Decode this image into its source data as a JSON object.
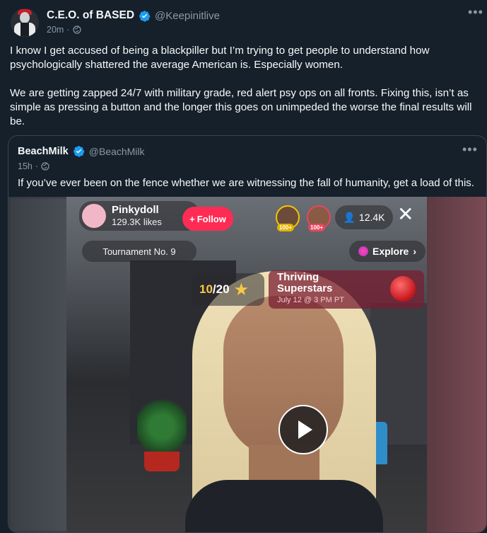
{
  "post": {
    "author_name": "C.E.O. of BASED",
    "author_handle": "@Keepinitlive",
    "time": "20m",
    "more_glyph": "•••",
    "paragraphs": [
      "I know I get accused of being a blackpiller but I’m trying to get people to understand how psychologically shattered the average American is. Especially women.",
      "We are getting zapped 24/7 with military grade, red alert psy ops on all fronts. Fixing this, isn’t as simple as pressing a button and the longer this goes on unimpeded the worse the final results will be."
    ]
  },
  "quoted": {
    "author_name": "BeachMilk",
    "author_handle": "@BeachMilk",
    "time": "15h",
    "more_glyph": "•••",
    "text": "If you’ve ever been on the fence whether we are witnessing the fall of humanity, get a load of this."
  },
  "video": {
    "host_name": "Pinkydoll",
    "host_likes": "129.3K likes",
    "follow_label": "Follow",
    "viewer1_badge": "100+",
    "viewer2_badge": "100+",
    "viewer_count": "12.4K",
    "tournament_label": "Tournament No. 9",
    "explore_label": "Explore",
    "progress_current": "10",
    "progress_total": "/20",
    "event_title": "Thriving Superstars",
    "event_date": "July 12 @ 3 PM PT"
  },
  "icons": {
    "verified": "verified-badge-icon",
    "globe": "globe-icon",
    "play": "play-icon",
    "close": "close-icon"
  },
  "colors": {
    "background": "#15202b",
    "text": "#f7f9f9",
    "muted": "#8b98a5",
    "verified_blue": "#1d9bf0",
    "follow_red": "#fe2c55"
  }
}
